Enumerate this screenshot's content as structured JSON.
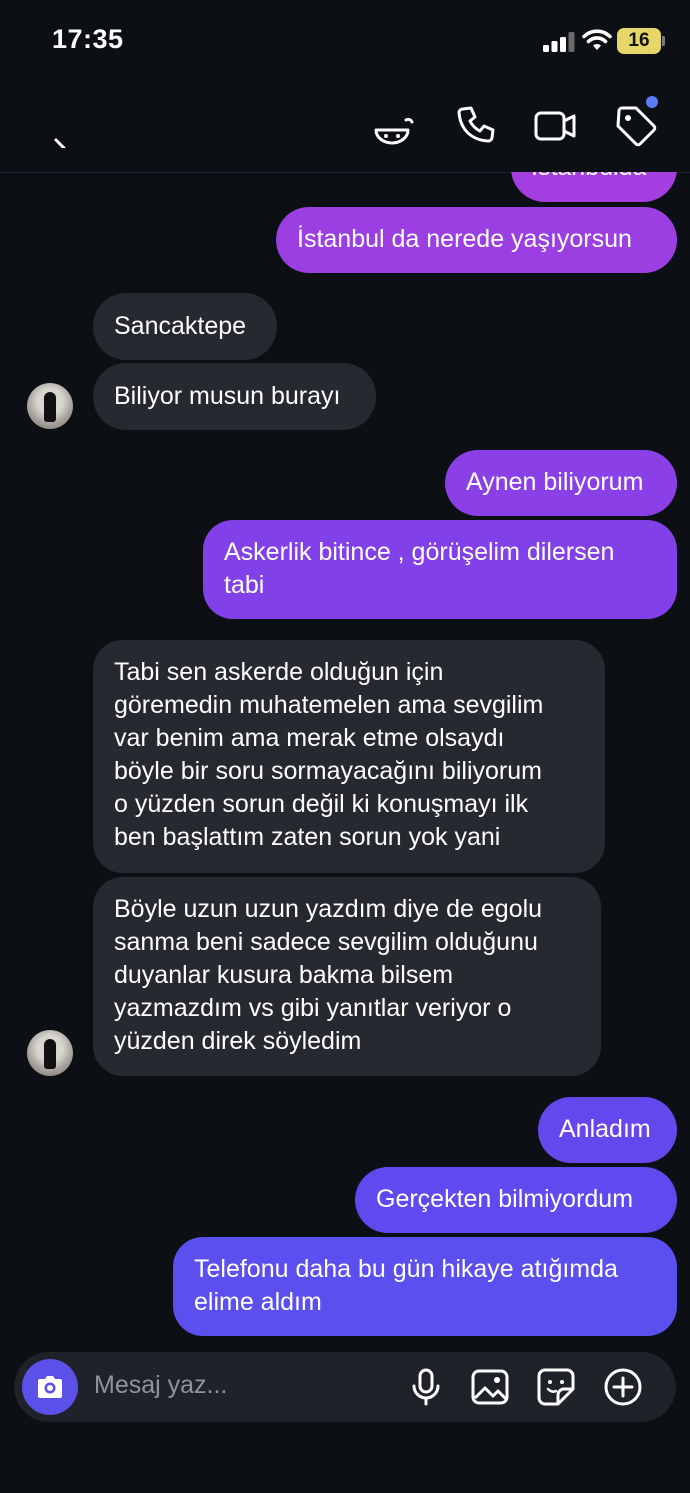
{
  "status": {
    "time": "17:35",
    "battery": "16"
  },
  "messages": [
    {
      "dir": "out",
      "text": "İstanbulda"
    },
    {
      "dir": "out",
      "text": "İstanbul da nerede yaşıyorsun"
    },
    {
      "dir": "in",
      "text": "Sancaktepe"
    },
    {
      "dir": "in",
      "text": "Biliyor musun burayı"
    },
    {
      "dir": "out",
      "text": "Aynen biliyorum"
    },
    {
      "dir": "out",
      "text": "Askerlik bitince , görüşelim dilersen\ntabi"
    },
    {
      "dir": "in",
      "text": "Tabi sen askerde olduğun için\ngöremedin muhatemelen ama sevgilim\nvar benim ama merak etme olsaydı\nböyle bir soru sormayacağını biliyorum\no yüzden sorun değil ki konuşmayı ilk\nben başlattım zaten sorun yok yani"
    },
    {
      "dir": "in",
      "text": "Böyle uzun uzun yazdım diye de egolu\nsanma beni sadece sevgilim olduğunu\nduyanlar kusura bakma bilsem\nyazmazdım vs gibi yanıtlar veriyor o\nyüzden direk söyledim"
    },
    {
      "dir": "out",
      "text": "Anladım"
    },
    {
      "dir": "out",
      "text": "Gerçekten bilmiyordum"
    },
    {
      "dir": "out",
      "text": "Telefonu daha bu gün hikaye atığımda\nelime aldım"
    }
  ],
  "composer": {
    "placeholder": "Mesaj yaz..."
  },
  "colors": {
    "bubble_in": "#26292f",
    "out_top": "#a43ee0",
    "out_bottom": "#5b4ff0",
    "accent": "#5b50e8"
  },
  "icons": [
    "signal-icon",
    "wifi-icon",
    "back-icon",
    "sticker-face-icon",
    "phone-icon",
    "video-icon",
    "tag-icon",
    "camera-icon",
    "mic-icon",
    "image-icon",
    "sticker-icon",
    "plus-icon"
  ]
}
